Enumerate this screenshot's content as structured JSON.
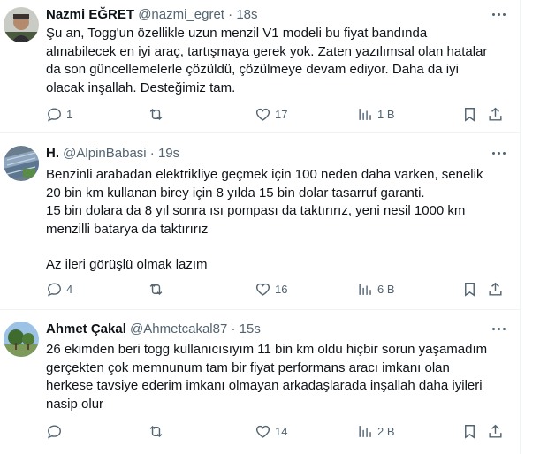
{
  "tweets": [
    {
      "name": "Nazmi EĞRET",
      "handle": "@nazmi_egret",
      "time": "18s",
      "lines": [
        "Şu an, Togg'un özellikle uzun menzil V1 modeli bu fiyat bandında",
        "alınabilecek en iyi araç, tartışmaya gerek yok. Zaten yazılımsal olan hatalar",
        "da son güncellemelerle çözüldü, çözülmeye devam ediyor. Daha da iyi",
        "olacak inşallah. Desteğimiz tam."
      ],
      "replies": "1",
      "retweets": "",
      "likes": "17",
      "views": "1 B"
    },
    {
      "name": "H.",
      "handle": "@AlpinBabasi",
      "time": "19s",
      "lines": [
        "Benzinli arabadan elektrikliye geçmek için 100 neden daha varken, senelik",
        "20 bin km kullanan birey için 8 yılda 15 bin dolar tasarruf garanti.",
        "15 bin dolara da 8 yıl sonra ısı pompası da taktırırız, yeni nesil 1000 km",
        "menzilli batarya da taktırırız",
        "",
        "Az ileri görüşlü olmak lazım"
      ],
      "replies": "4",
      "retweets": "",
      "likes": "16",
      "views": "6 B"
    },
    {
      "name": "Ahmet Çakal",
      "handle": "@Ahmetcakal87",
      "time": "15s",
      "lines": [
        "26 ekimden beri togg kullanıcısıyım 11 bin km oldu hiçbir sorun yaşamadım",
        "gerçekten çok memnunum tam bir fiyat performans aracı imkanı olan",
        "herkese tavsiye ederim imkanı olmayan arkadaşlarada inşallah daha iyileri",
        "nasip olur"
      ],
      "replies": "",
      "retweets": "",
      "likes": "14",
      "views": "2 B"
    }
  ],
  "separator": "·",
  "icons": [
    "reply-icon",
    "retweet-icon",
    "like-icon",
    "views-icon",
    "bookmark-icon",
    "share-icon",
    "more-icon"
  ]
}
